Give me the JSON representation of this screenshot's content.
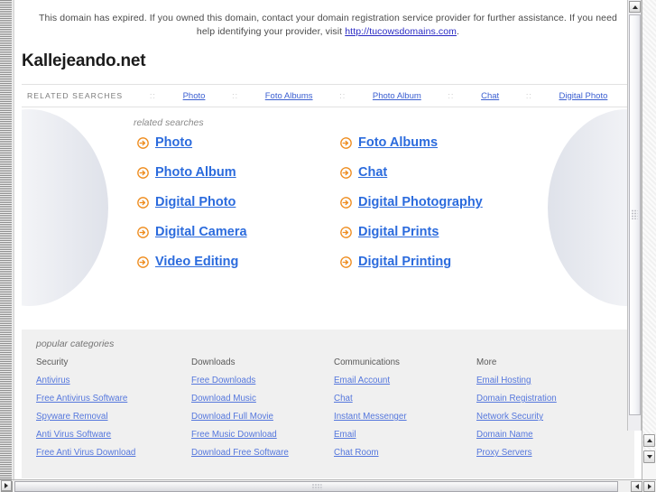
{
  "notice": {
    "text_before": "This domain has expired. If you owned this domain, contact your domain registration service provider for further assistance. If you need help identifying your provider, visit ",
    "link": "http://tucowsdomains.com",
    "text_after": "."
  },
  "domain": {
    "title": "Kallejeando.net"
  },
  "nav": {
    "label": "RELATED SEARCHES",
    "separator": "::",
    "links": [
      "Photo",
      "Foto Albums",
      "Photo Album",
      "Chat",
      "Digital Photo"
    ]
  },
  "hero": {
    "title": "related searches",
    "icon": "arrow-circle-right-icon",
    "items": [
      "Photo",
      "Foto Albums",
      "Photo Album",
      "Chat",
      "Digital Photo",
      "Digital Photography",
      "Digital Camera",
      "Digital Prints",
      "Video Editing",
      "Digital Printing"
    ]
  },
  "categories": {
    "title": "popular categories",
    "columns": [
      {
        "heading": "Security",
        "links": [
          "Antivirus",
          "Free Antivirus Software",
          "Spyware Removal",
          "Anti Virus Software",
          "Free Anti Virus Download"
        ]
      },
      {
        "heading": "Downloads",
        "links": [
          "Free Downloads",
          "Download Music",
          "Download Full Movie",
          "Free Music Download",
          "Download Free Software"
        ]
      },
      {
        "heading": "Communications",
        "links": [
          "Email Account",
          "Chat",
          "Instant Messenger",
          "Email",
          "Chat Room"
        ]
      },
      {
        "heading": "More",
        "links": [
          "Email Hosting",
          "Domain Registration",
          "Network Security",
          "Domain Name",
          "Proxy Servers"
        ]
      }
    ]
  },
  "colors": {
    "link_blue": "#2b6bdd",
    "nav_link_blue": "#3b5fd1",
    "category_link_blue": "#5577dd",
    "icon_orange": "#f08a1e",
    "panel_gray": "#f0f0f0"
  }
}
